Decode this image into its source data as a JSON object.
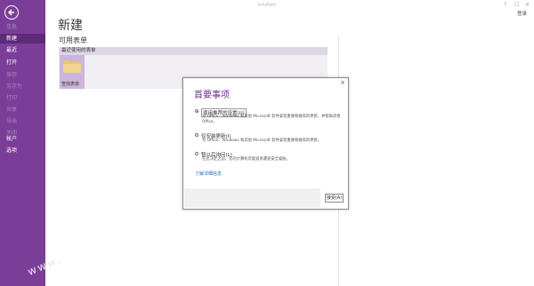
{
  "app": {
    "title": "InfoPath",
    "sign_in": "登录"
  },
  "window": {
    "min": "?",
    "restore": "☐",
    "close": "✕"
  },
  "sidebar": {
    "items": [
      {
        "label": "信息",
        "state": "dim"
      },
      {
        "label": "新建",
        "state": "active"
      },
      {
        "label": "最近",
        "state": "normal"
      },
      {
        "label": "打开",
        "state": "normal"
      },
      {
        "label": "保存",
        "state": "dim"
      },
      {
        "label": "另存为",
        "state": "dim"
      },
      {
        "label": "打印",
        "state": "dim"
      },
      {
        "label": "共享",
        "state": "dim"
      },
      {
        "label": "导出",
        "state": "dim"
      },
      {
        "label": "关闭",
        "state": "dim"
      },
      {
        "label": "帐户",
        "state": "normal"
      },
      {
        "label": "选项",
        "state": "normal"
      }
    ]
  },
  "main": {
    "title": "新建",
    "section_title": "可用表单",
    "panel_header": "最近使用的表单",
    "tile_label": "查找表单"
  },
  "dialog": {
    "title": "首要事项",
    "close": "×",
    "options": [
      {
        "label": "使用推荐的设置(U)",
        "desc": "为 Office、Windows 和其他 Microsoft 软件安装重要和推荐的更新，并帮助改善 Office。",
        "selected": true
      },
      {
        "label": "仅安装更新(I)",
        "desc": "为 Office、Windows 和其他 Microsoft 软件安装重要和推荐的更新。",
        "selected": false
      },
      {
        "label": "暂以后询问(L)",
        "desc": "在您决定之前，您的计算机可能容易遭受安全威胁。",
        "selected": false
      }
    ],
    "learn_more": "了解详细信息",
    "accept": "接受(A)"
  }
}
